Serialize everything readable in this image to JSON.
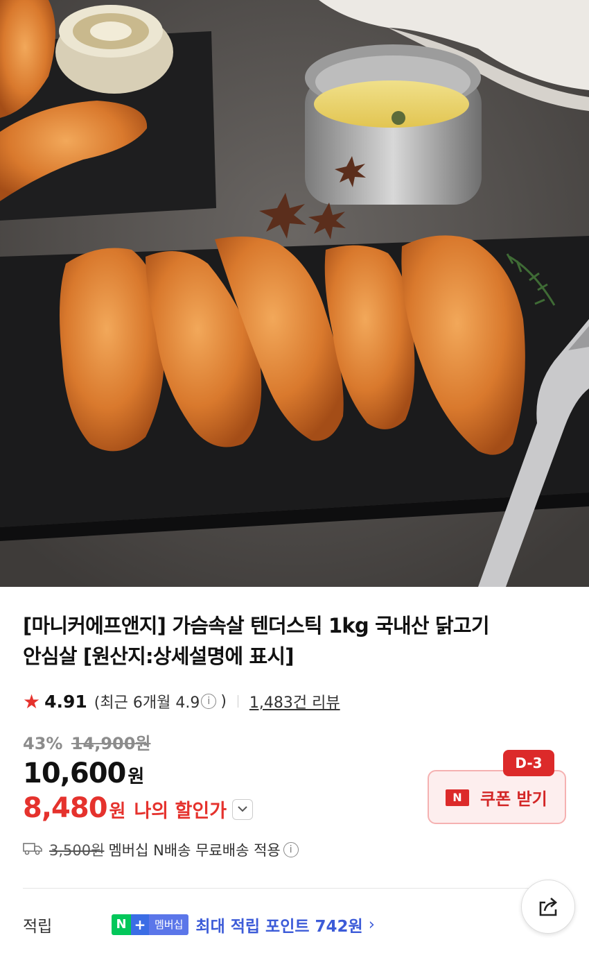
{
  "product": {
    "image_alt": "fried chicken tender sticks on slate plate",
    "title_line1": "[마니커에프앤지] 가슴속살 텐더스틱 1kg 국내산 닭고기",
    "title_line2": "안심살 [원산지:상세설명에 표시]"
  },
  "rating": {
    "score": "4.91",
    "recent_open": "(최근 6개월 4.9",
    "recent_close": ")",
    "info_glyph": "i",
    "review_count": "1,483건 리뷰"
  },
  "pricing": {
    "discount_pct": "43%",
    "original_price": "14,900원",
    "price": "10,600",
    "price_unit": "원",
    "my_price": "8,480",
    "my_price_unit": "원",
    "my_price_label": "나의 할인가"
  },
  "coupon": {
    "badge": "D-3",
    "n_label": "N",
    "label": "쿠폰 받기"
  },
  "shipping": {
    "fee": "3,500원",
    "text": "멤버십 N배송 무료배송 적용",
    "info_glyph": "i"
  },
  "points": {
    "label": "적립",
    "badge_n": "N",
    "badge_plus": "+",
    "badge_membership": "멤버십",
    "text": "최대 적립 포인트 742원",
    "chevron": "›"
  },
  "colors": {
    "accent_red": "#e5322d",
    "naver_green": "#03c75a",
    "membership_blue": "#3c5bd8"
  }
}
